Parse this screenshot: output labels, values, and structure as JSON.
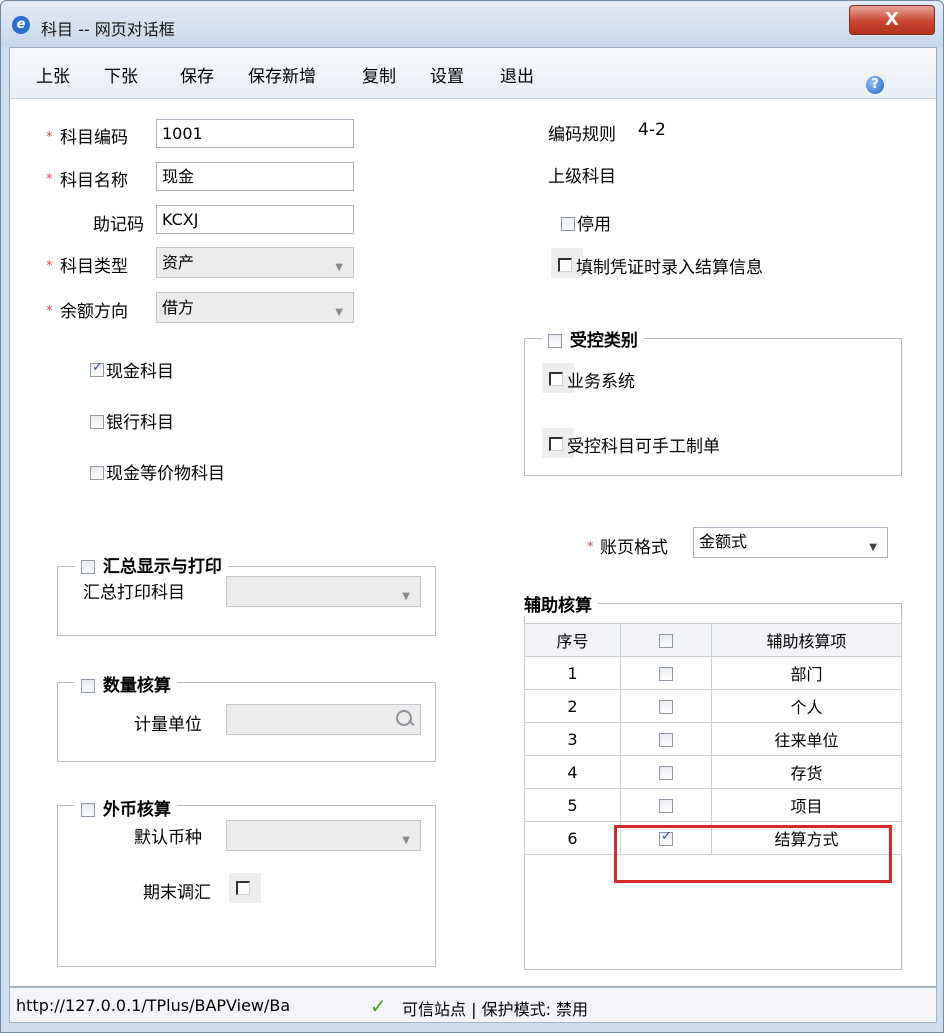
{
  "window": {
    "title": "科目 -- 网页对话框",
    "close_label": "X"
  },
  "menu": {
    "items": [
      "上张",
      "下张",
      "保存",
      "保存新增",
      "复制",
      "设置",
      "退出"
    ],
    "help": "?"
  },
  "form": {
    "required_mark": "*",
    "code_label": "科目编码",
    "code_value": "1001",
    "name_label": "科目名称",
    "name_value": "现金",
    "mnemonic_label": "助记码",
    "mnemonic_value": "KCXJ",
    "type_label": "科目类型",
    "type_value": "资产",
    "balance_label": "余额方向",
    "balance_value": "借方",
    "cash_label": "现金科目",
    "cash_checked": true,
    "bank_label": "银行科目",
    "bank_checked": false,
    "cash_eq_label": "现金等价物科目",
    "cash_eq_checked": false,
    "code_rule_label": "编码规则",
    "code_rule_value": "4-2",
    "parent_label": "上级科目",
    "disabled_label": "停用",
    "settle_input_label": "填制凭证时录入结算信息",
    "ledger_format_label": "账页格式",
    "ledger_format_value": "金额式"
  },
  "controlled": {
    "legend": "受控类别",
    "business_label": "业务系统",
    "manual_label": "受控科目可手工制单"
  },
  "summary": {
    "legend": "汇总显示与打印",
    "print_label": "汇总打印科目"
  },
  "quantity": {
    "legend": "数量核算",
    "unit_label": "计量单位"
  },
  "foreign": {
    "legend": "外币核算",
    "currency_label": "默认币种",
    "adjust_label": "期末调汇"
  },
  "aux": {
    "legend": "辅助核算",
    "headers": {
      "seq": "序号",
      "item": "辅助核算项"
    },
    "rows": [
      {
        "seq": "1",
        "item": "部门",
        "checked": false
      },
      {
        "seq": "2",
        "item": "个人",
        "checked": false
      },
      {
        "seq": "3",
        "item": "往来单位",
        "checked": false
      },
      {
        "seq": "4",
        "item": "存货",
        "checked": false
      },
      {
        "seq": "5",
        "item": "项目",
        "checked": false
      },
      {
        "seq": "6",
        "item": "结算方式",
        "checked": true
      }
    ]
  },
  "status": {
    "url": "http://127.0.0.1/TPlus/BAPView/Ba",
    "zone": "可信站点 | 保护模式: 禁用"
  },
  "colors": {
    "required": "#d64b3a",
    "highlight": "#d42a2a",
    "title_bar": "#c7d7ea"
  }
}
